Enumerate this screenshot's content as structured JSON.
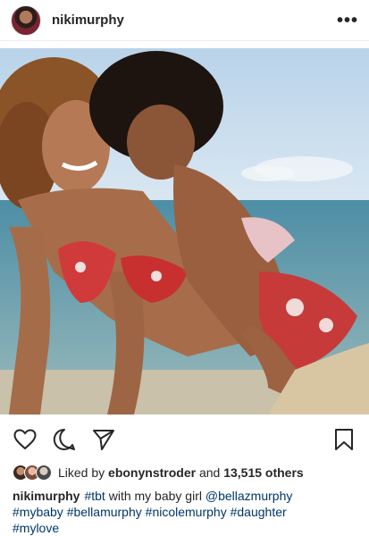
{
  "post": {
    "username": "nikimurphy",
    "more_icon": "more-horizontal-icon"
  },
  "actions": {
    "icons": [
      "heart-icon",
      "comment-icon",
      "share-icon",
      "bookmark-icon"
    ]
  },
  "likes": {
    "prefix": "Liked by",
    "first_liker": "ebonynstroder",
    "middle": "and",
    "count": "13,515 others"
  },
  "caption": {
    "username": "nikimurphy",
    "line1_tag1": "#tbt",
    "line1_text": "with my baby girl",
    "line1_mention": "@bellazmurphy",
    "line2_tags": [
      "#mybaby",
      "#bellamurphy",
      "#nicolemurphy",
      "#daughter"
    ],
    "line3_tag": "#mylove"
  },
  "colors": {
    "link": "#003569",
    "text": "#262626"
  }
}
